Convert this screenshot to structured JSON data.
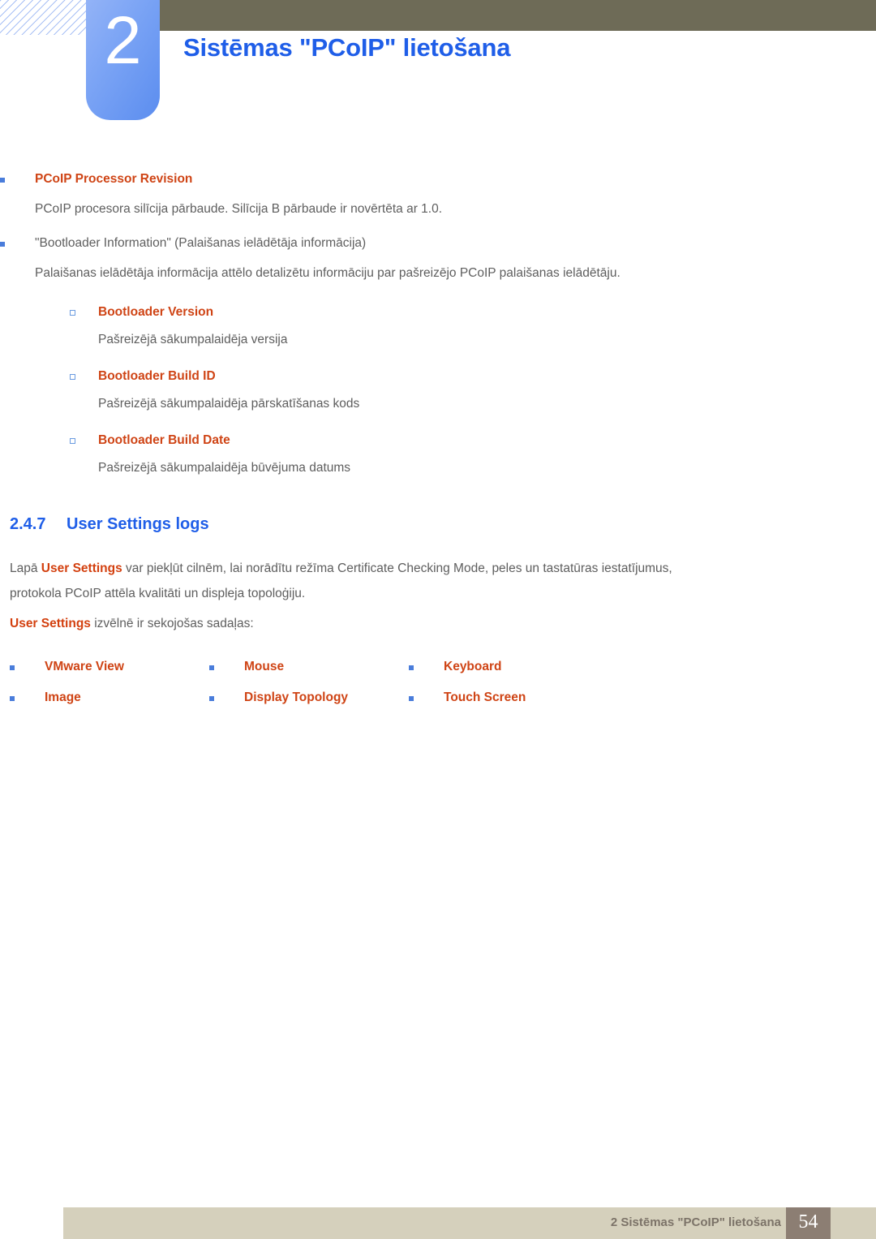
{
  "header": {
    "chapter_number": "2",
    "chapter_title": "Sistēmas \"PCoIP\" lietošana",
    "olive_bar_color": "#6e6b57",
    "tab_color": "#7ba4f5",
    "title_color": "#1f5ee8"
  },
  "content": {
    "bullets": [
      {
        "marker": "blue-square-bullet",
        "heading": "PCoIP Processor Revision",
        "heading_color": "#cf4415",
        "body": "PCoIP procesora silīcija pārbaude. Silīcija B pārbaude ir novērtēta ar 1.0."
      },
      {
        "marker": "blue-square-bullet",
        "heading": "\"Bootloader Information\" (Palaišanas ielādētāja informācija)",
        "heading_color": "#5e5e5e",
        "body": "Palaišanas ielādētāja informācija attēlo detalizētu informāciju par pašreizējo PCoIP palaišanas ielādētāju."
      }
    ],
    "sub_items": [
      {
        "marker": "hollow-square-bullet",
        "heading": "Bootloader Version",
        "description": "Pašreizējā sākumpalaidēja versija"
      },
      {
        "marker": "hollow-square-bullet",
        "heading": "Bootloader Build ID",
        "description": "Pašreizējā sākumpalaidēja pārskatīšanas kods"
      },
      {
        "marker": "hollow-square-bullet",
        "heading": "Bootloader Build Date",
        "description": "Pašreizējā sākumpalaidēja būvējuma datums"
      }
    ],
    "section": {
      "number": "2.4.7",
      "title": "User Settings logs",
      "color": "#1f5ee8"
    },
    "paragraph_1": {
      "pre": "Lapā ",
      "emphasis": "User Settings",
      "post": " var piekļūt cilnēm, lai norādītu režīma Certificate Checking Mode, peles un tastatūras iestatījumus, protokola PCoIP attēla kvalitāti un displeja topoloģiju."
    },
    "paragraph_2": {
      "emphasis": "User Settings",
      "post": " izvēlnē ir sekojošas sadaļas:"
    },
    "menu_columns": [
      [
        "VMware View",
        "Image"
      ],
      [
        "Mouse",
        "Display Topology"
      ],
      [
        "Keyboard",
        "Touch Screen"
      ]
    ]
  },
  "footer": {
    "text": "2 Sistēmas \"PCoIP\" lietošana",
    "page_number": "54",
    "bar_color": "#d5d0bc",
    "page_box_color": "#8c7e73"
  }
}
